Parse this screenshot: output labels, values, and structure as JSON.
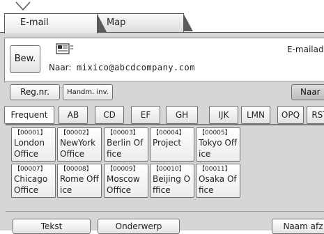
{
  "tabs": {
    "email": "E-mail",
    "map": "Map"
  },
  "address": {
    "bew_label": "Bew.",
    "naar_label": "Naar:",
    "naar_value": "mixico@abcdcompany.com",
    "email_address_label": "E-mailadc"
  },
  "buttons": {
    "regnr": "Reg.nr.",
    "handm": "Handm. inv.",
    "naar": "Naar"
  },
  "alpha_tabs": [
    "Frequent",
    "AB",
    "CD",
    "EF",
    "GH",
    "IJK",
    "LMN",
    "OPQ",
    "RST"
  ],
  "contacts": [
    {
      "num": "【00001】",
      "name": "London Office"
    },
    {
      "num": "【00002】",
      "name": "NewYork Office"
    },
    {
      "num": "【00003】",
      "name": "Berlin Office"
    },
    {
      "num": "【00004】",
      "name": "Project"
    },
    {
      "num": "【00005】",
      "name": "Tokyo Office"
    },
    {
      "num": "【00007】",
      "name": "Chicago Office"
    },
    {
      "num": "【00008】",
      "name": "Rome Office"
    },
    {
      "num": "【00009】",
      "name": "Moscow Office"
    },
    {
      "num": "【00010】",
      "name": "Beijing Office"
    },
    {
      "num": "【00011】",
      "name": "Osaka Office"
    }
  ],
  "bottom": {
    "tekst": "Tekst",
    "onderwerp": "Onderwerp",
    "naam_afz": "Naam afz"
  }
}
